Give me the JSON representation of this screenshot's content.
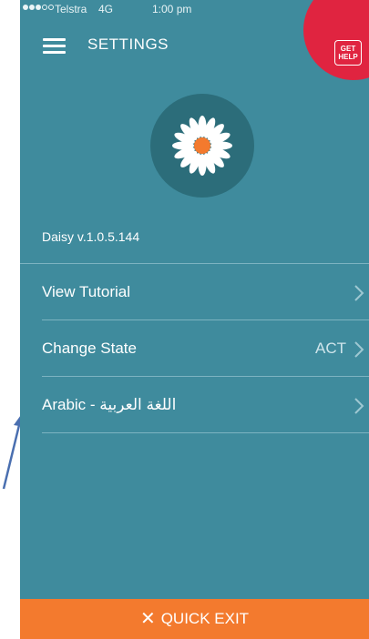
{
  "status_bar": {
    "carrier": "Telstra",
    "network": "4G",
    "time": "1:00 pm"
  },
  "header": {
    "title": "SETTINGS",
    "get_help_line1": "GET",
    "get_help_line2": "HELP"
  },
  "app": {
    "version": "Daisy v.1.0.5.144"
  },
  "menu": {
    "items": [
      {
        "label": "View Tutorial",
        "value": ""
      },
      {
        "label": "Change State",
        "value": "ACT"
      },
      {
        "label": "Arabic - اللغة العربية",
        "value": ""
      }
    ]
  },
  "footer": {
    "quick_exit_label": "QUICK EXIT"
  },
  "colors": {
    "background": "#3f8b9d",
    "quick_exit": "#f37a2e",
    "get_help": "#e02440",
    "logo_circle": "#2c6d7a",
    "flower_center": "#f37a2e"
  },
  "icons": [
    "menu-icon",
    "daisy-logo-icon",
    "chevron-right-icon",
    "close-icon",
    "help-icon",
    "annotation-arrow-icon"
  ]
}
